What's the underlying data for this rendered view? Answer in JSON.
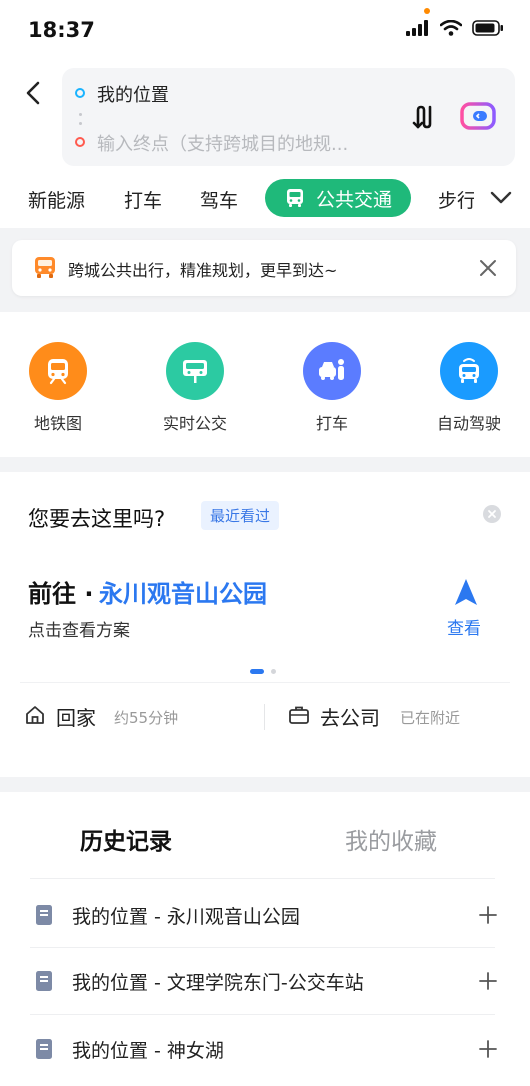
{
  "status_bar": {
    "time": "18:37"
  },
  "route": {
    "start": "我的位置",
    "end_placeholder": "输入终点（支持跨城目的地规..."
  },
  "modes": {
    "items": [
      "新能源",
      "打车",
      "驾车",
      "公共交通",
      "步行"
    ],
    "active": "公共交通"
  },
  "banner": {
    "text": "跨城公共出行，精准规划，更早到达~"
  },
  "quick_apps": [
    {
      "label": "地铁图",
      "color": "#ff8c1a"
    },
    {
      "label": "实时公交",
      "color": "#2ccaa2"
    },
    {
      "label": "打车",
      "color": "#5b7cff"
    },
    {
      "label": "自动驾驶",
      "color": "#1a9bff"
    }
  ],
  "suggestion": {
    "title": "您要去这里吗?",
    "badge": "最近看过",
    "go_prefix": "前往 ·",
    "destination": "永川观音山公园",
    "subtitle": "点击查看方案",
    "nav_label": "查看"
  },
  "shortcuts": {
    "home_label": "回家",
    "home_sub": "约55分钟",
    "work_label": "去公司",
    "work_sub": "已在附近"
  },
  "history_tabs": {
    "history": "历史记录",
    "favorites": "我的收藏"
  },
  "history_items": [
    "我的位置 - 永川观音山公园",
    "我的位置 - 文理学院东门-公交车站",
    "我的位置 - 神女湖"
  ]
}
